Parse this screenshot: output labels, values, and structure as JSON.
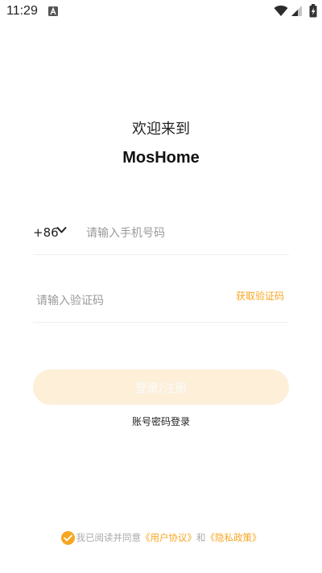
{
  "status_bar": {
    "time": "11:29",
    "icons": [
      "a-notification-icon",
      "wifi-icon",
      "signal-icon",
      "battery-icon"
    ]
  },
  "header": {
    "welcome": "欢迎来到",
    "brand": "MosHome"
  },
  "phone": {
    "country_code": "+86",
    "placeholder": "请输入手机号码"
  },
  "verification": {
    "placeholder": "请输入验证码",
    "get_code_label": "获取验证码"
  },
  "actions": {
    "login_label": "登录/注册",
    "password_login_label": "账号密码登录"
  },
  "agreement": {
    "prefix": "我已阅读并同意",
    "user_agreement": "《用户协议》",
    "and": "和",
    "privacy_policy": "《隐私政策》"
  },
  "colors": {
    "accent": "#f6a623",
    "button_disabled_bg": "#fdefd8",
    "placeholder": "#9a9a9a"
  }
}
